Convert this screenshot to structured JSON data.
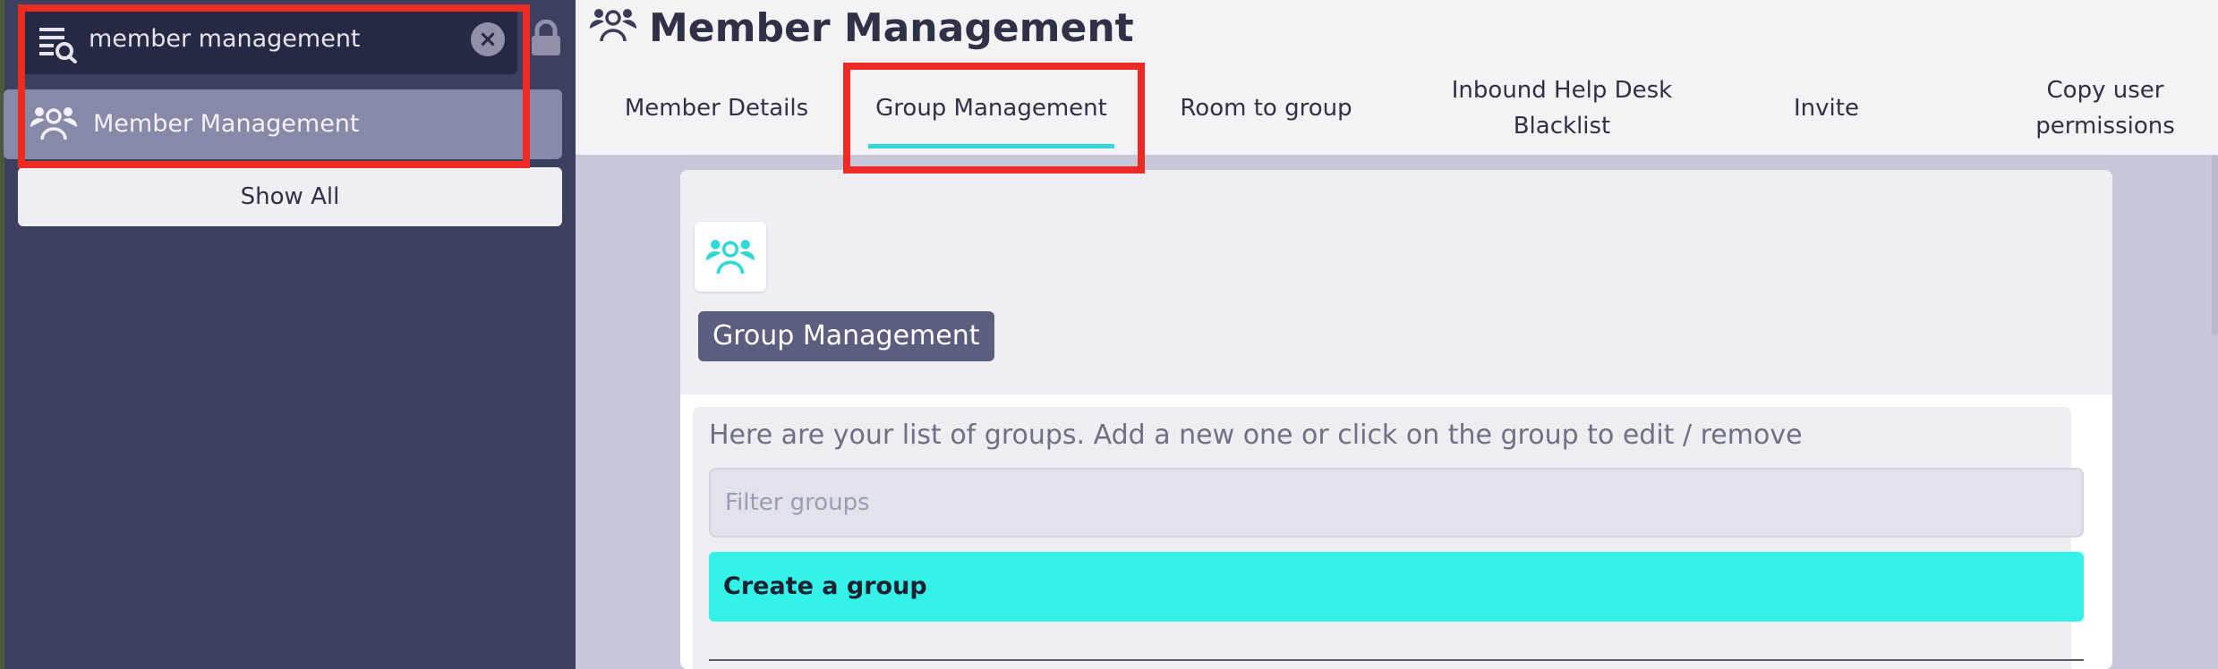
{
  "sidebar": {
    "search": {
      "value": "member management"
    },
    "clear_label": "×",
    "items": [
      {
        "label": "Member Management"
      }
    ],
    "show_all_label": "Show All"
  },
  "header": {
    "title": "Member Management",
    "tabs": [
      {
        "label": "Member Details"
      },
      {
        "label": "Group Management"
      },
      {
        "label": "Room to group"
      },
      {
        "label": "Inbound Help Desk Blacklist"
      },
      {
        "label": "Invite"
      },
      {
        "label": "Copy user permissions"
      }
    ]
  },
  "card": {
    "title": "Group Management",
    "intro": "Here are your list of groups. Add a new one or click on the group to edit / remove",
    "filter_placeholder": "Filter groups",
    "create_label": "Create a group"
  },
  "colors": {
    "sidebar_bg": "#3d405c",
    "accent": "#33f2e7",
    "highlight": "#ee2a23",
    "badge_bg": "#5b5e7e"
  },
  "icons": [
    "menu-search-icon",
    "close-icon",
    "lock-icon",
    "members-icon"
  ]
}
